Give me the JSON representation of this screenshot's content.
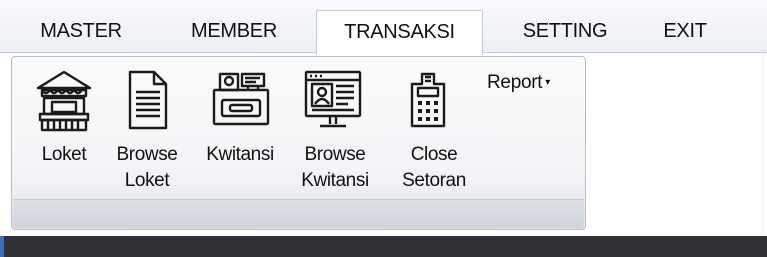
{
  "menu": {
    "tabs": [
      {
        "label": "MASTER"
      },
      {
        "label": "MEMBER"
      },
      {
        "label": "TRANSAKSI",
        "active": true
      },
      {
        "label": "SETTING"
      },
      {
        "label": "EXIT"
      }
    ]
  },
  "ribbon": {
    "buttons": [
      {
        "label_line1": "Loket",
        "label_line2": "",
        "icon": "kiosk-booth-icon"
      },
      {
        "label_line1": "Browse",
        "label_line2": "Loket",
        "icon": "document-list-icon"
      },
      {
        "label_line1": "Kwitansi",
        "label_line2": "",
        "icon": "cash-register-icon"
      },
      {
        "label_line1": "Browse",
        "label_line2": "Kwitansi",
        "icon": "monitor-profile-icon"
      },
      {
        "label_line1": "Close",
        "label_line2": "Setoran",
        "icon": "calculator-icon"
      }
    ],
    "report_label": "Report",
    "report_arrow": "▾"
  }
}
